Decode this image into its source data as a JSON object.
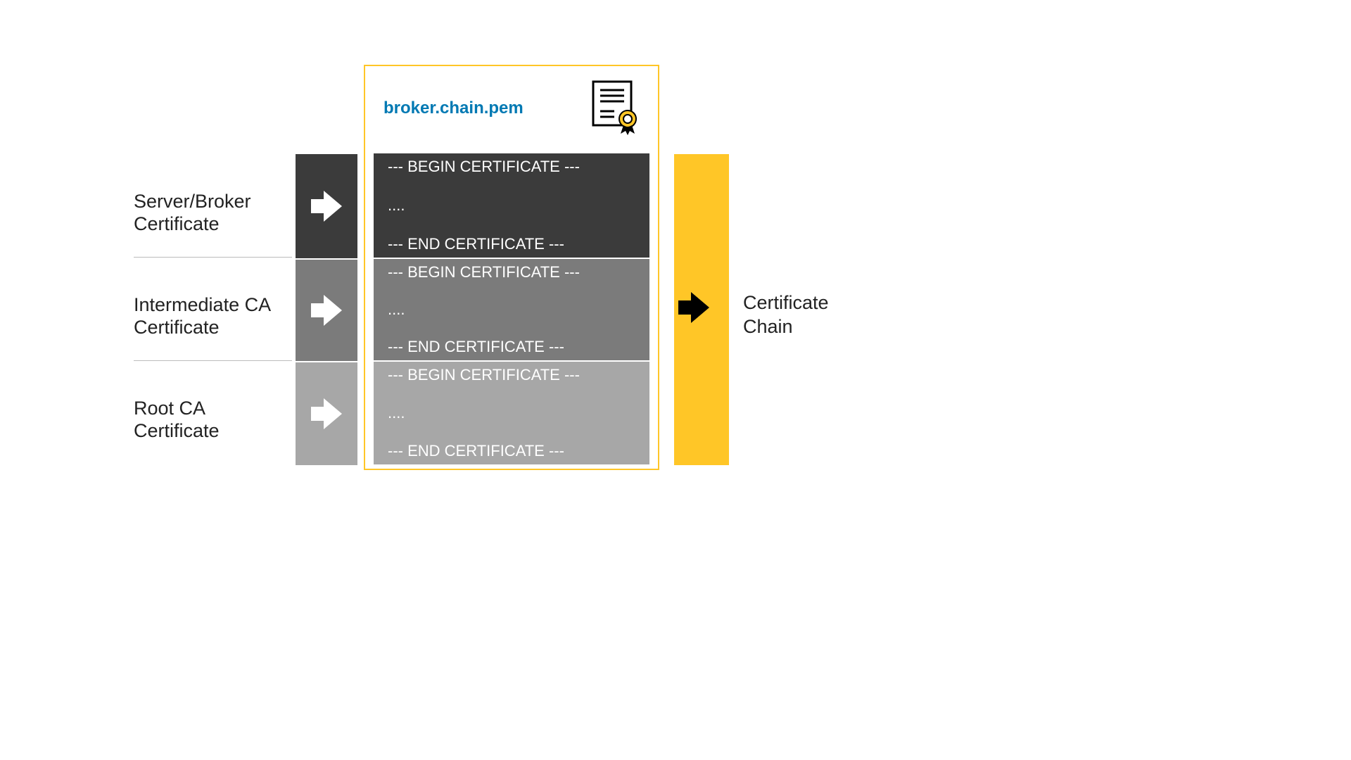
{
  "labels": {
    "server": {
      "line1": "Server/Broker",
      "line2": "Certificate"
    },
    "intermediate": {
      "line1": "Intermediate CA",
      "line2": "Certificate"
    },
    "root": {
      "line1": "Root CA",
      "line2": "Certificate"
    }
  },
  "file": {
    "title": "broker.chain.pem",
    "blocks": [
      {
        "begin": "--- BEGIN CERTIFICATE ---",
        "body": "....",
        "end": "--- END CERTIFICATE ---"
      },
      {
        "begin": "--- BEGIN CERTIFICATE ---",
        "body": "....",
        "end": "--- END CERTIFICATE ---"
      },
      {
        "begin": "--- BEGIN CERTIFICATE ---",
        "body": "....",
        "end": "--- END CERTIFICATE ---"
      }
    ]
  },
  "output": {
    "line1": "Certificate",
    "line2": "Chain"
  },
  "colors": {
    "accent": "#ffc627",
    "titleBlue": "#0079b3",
    "dark": "#3b3b3b",
    "mid": "#7b7b7b",
    "light": "#a7a7a7",
    "text": "#222222"
  }
}
